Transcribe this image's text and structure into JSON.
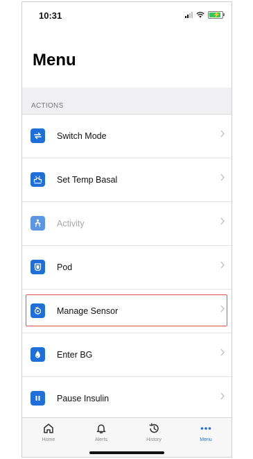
{
  "status_bar": {
    "time": "10:31"
  },
  "header": {
    "title": "Menu"
  },
  "section": {
    "label": "ACTIONS"
  },
  "menu": {
    "items": [
      {
        "label": "Switch Mode",
        "icon": "switch-mode-icon",
        "enabled": true
      },
      {
        "label": "Set Temp Basal",
        "icon": "temp-basal-icon",
        "enabled": true
      },
      {
        "label": "Activity",
        "icon": "activity-icon",
        "enabled": false
      },
      {
        "label": "Pod",
        "icon": "pod-icon",
        "enabled": true
      },
      {
        "label": "Manage Sensor",
        "icon": "sensor-icon",
        "enabled": true,
        "highlighted": true
      },
      {
        "label": "Enter BG",
        "icon": "blood-drop-icon",
        "enabled": true
      },
      {
        "label": "Pause Insulin",
        "icon": "pause-icon",
        "enabled": true
      }
    ]
  },
  "tab_bar": {
    "tabs": [
      {
        "label": "Home",
        "icon": "home-icon"
      },
      {
        "label": "Alerts",
        "icon": "bell-icon"
      },
      {
        "label": "History",
        "icon": "history-icon"
      },
      {
        "label": "Menu",
        "icon": "more-icon",
        "active": true
      }
    ]
  },
  "colors": {
    "accent": "#1e6fd9",
    "highlight_border": "#e0534d",
    "disabled_text": "#a8a8a8"
  }
}
